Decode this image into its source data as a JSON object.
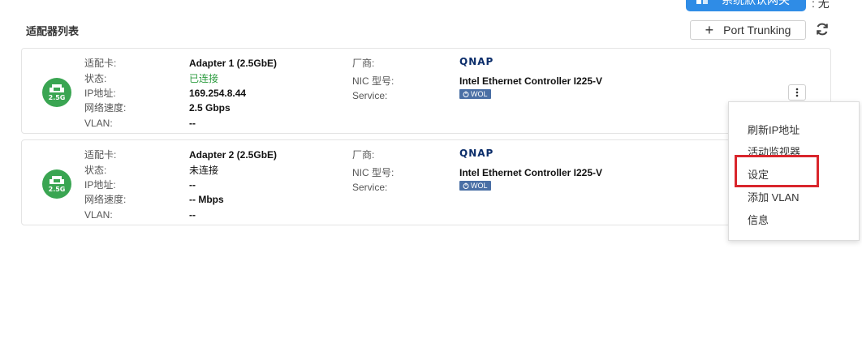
{
  "topbar": {
    "gateway_button_label": "系统默认网关",
    "gateway_suffix": ": 无"
  },
  "section": {
    "title": "适配器列表",
    "port_trunking_label": "Port Trunking"
  },
  "labels": {
    "adapter": "适配卡:",
    "status": "状态:",
    "ip": "IP地址:",
    "speed": "网络速度:",
    "vlan": "VLAN:",
    "vendor": "厂商:",
    "nic_model": "NIC 型号:",
    "service": "Service:"
  },
  "adapters": [
    {
      "badge": "2.5G",
      "name": "Adapter 1 (2.5GbE)",
      "status": "已连接",
      "ip": "169.254.8.44",
      "speed": "2.5 Gbps",
      "vlan": "--",
      "vendor": "QNAP",
      "nic_model": "Intel Ethernet Controller I225-V",
      "service": "WOL"
    },
    {
      "badge": "2.5G",
      "name": "Adapter 2 (2.5GbE)",
      "status": "未连接",
      "ip": "--",
      "speed": "-- Mbps",
      "vlan": "--",
      "vendor": "QNAP",
      "nic_model": "Intel Ethernet Controller I225-V",
      "service": "WOL"
    }
  ],
  "context_menu": {
    "items": [
      "刷新IP地址",
      "活动监视器",
      "设定",
      "添加 VLAN",
      "信息"
    ],
    "highlighted_index": 2
  },
  "colors": {
    "accent": "#2f8ce6",
    "connected": "#2a9a3d",
    "badge_green": "#3aa552",
    "highlight_red": "#d9262c"
  }
}
